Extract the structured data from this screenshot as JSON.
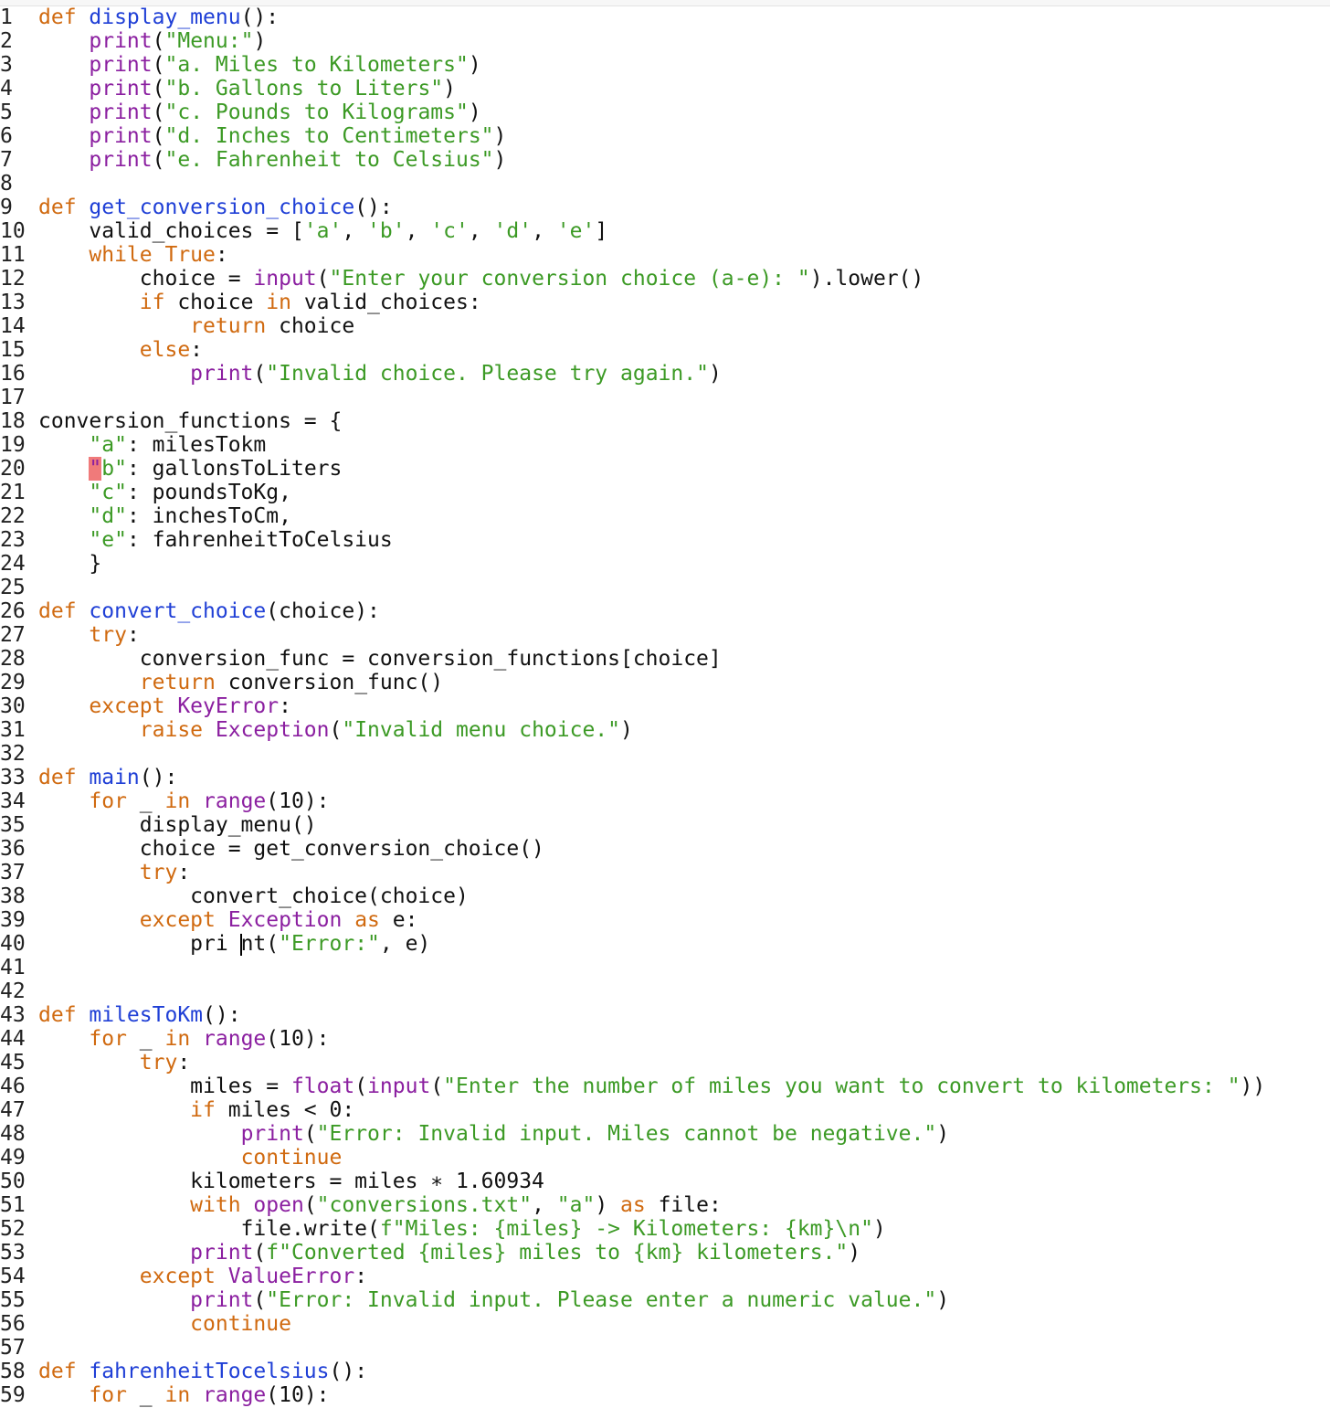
{
  "colors": {
    "keyword": "#d06a10",
    "function_name": "#1f3fd6",
    "builtin": "#8b1fa0",
    "string": "#3c9a25",
    "text": "#111111",
    "highlight": "#f07a7a"
  },
  "editor": {
    "lines": [
      {
        "n": "1",
        "tokens": [
          {
            "t": "kw",
            "v": "def "
          },
          {
            "t": "def",
            "v": "display_menu"
          },
          {
            "t": "text",
            "v": "():"
          }
        ]
      },
      {
        "n": "2",
        "tokens": [
          {
            "t": "text",
            "v": "    "
          },
          {
            "t": "builtin",
            "v": "print"
          },
          {
            "t": "text",
            "v": "("
          },
          {
            "t": "str",
            "v": "\"Menu:\""
          },
          {
            "t": "text",
            "v": ")"
          }
        ]
      },
      {
        "n": "3",
        "tokens": [
          {
            "t": "text",
            "v": "    "
          },
          {
            "t": "builtin",
            "v": "print"
          },
          {
            "t": "text",
            "v": "("
          },
          {
            "t": "str",
            "v": "\"a. Miles to Kilometers\""
          },
          {
            "t": "text",
            "v": ")"
          }
        ]
      },
      {
        "n": "4",
        "tokens": [
          {
            "t": "text",
            "v": "    "
          },
          {
            "t": "builtin",
            "v": "print"
          },
          {
            "t": "text",
            "v": "("
          },
          {
            "t": "str",
            "v": "\"b. Gallons to Liters\""
          },
          {
            "t": "text",
            "v": ")"
          }
        ]
      },
      {
        "n": "5",
        "tokens": [
          {
            "t": "text",
            "v": "    "
          },
          {
            "t": "builtin",
            "v": "print"
          },
          {
            "t": "text",
            "v": "("
          },
          {
            "t": "str",
            "v": "\"c. Pounds to Kilograms\""
          },
          {
            "t": "text",
            "v": ")"
          }
        ]
      },
      {
        "n": "6",
        "tokens": [
          {
            "t": "text",
            "v": "    "
          },
          {
            "t": "builtin",
            "v": "print"
          },
          {
            "t": "text",
            "v": "("
          },
          {
            "t": "str",
            "v": "\"d. Inches to Centimeters\""
          },
          {
            "t": "text",
            "v": ")"
          }
        ]
      },
      {
        "n": "7",
        "tokens": [
          {
            "t": "text",
            "v": "    "
          },
          {
            "t": "builtin",
            "v": "print"
          },
          {
            "t": "text",
            "v": "("
          },
          {
            "t": "str",
            "v": "\"e. Fahrenheit to Celsius\""
          },
          {
            "t": "text",
            "v": ")"
          }
        ]
      },
      {
        "n": "8",
        "tokens": []
      },
      {
        "n": "9",
        "tokens": [
          {
            "t": "kw",
            "v": "def "
          },
          {
            "t": "def",
            "v": "get_conversion_choice"
          },
          {
            "t": "text",
            "v": "():"
          }
        ]
      },
      {
        "n": "10",
        "tokens": [
          {
            "t": "text",
            "v": "    valid_choices = ["
          },
          {
            "t": "str",
            "v": "'a'"
          },
          {
            "t": "text",
            "v": ", "
          },
          {
            "t": "str",
            "v": "'b'"
          },
          {
            "t": "text",
            "v": ", "
          },
          {
            "t": "str",
            "v": "'c'"
          },
          {
            "t": "text",
            "v": ", "
          },
          {
            "t": "str",
            "v": "'d'"
          },
          {
            "t": "text",
            "v": ", "
          },
          {
            "t": "str",
            "v": "'e'"
          },
          {
            "t": "text",
            "v": "]"
          }
        ]
      },
      {
        "n": "11",
        "tokens": [
          {
            "t": "text",
            "v": "    "
          },
          {
            "t": "kw",
            "v": "while True"
          },
          {
            "t": "text",
            "v": ":"
          }
        ]
      },
      {
        "n": "12",
        "tokens": [
          {
            "t": "text",
            "v": "        choice = "
          },
          {
            "t": "builtin",
            "v": "input"
          },
          {
            "t": "text",
            "v": "("
          },
          {
            "t": "str",
            "v": "\"Enter your conversion choice (a-e): \""
          },
          {
            "t": "text",
            "v": ").lower()"
          }
        ]
      },
      {
        "n": "13",
        "tokens": [
          {
            "t": "text",
            "v": "        "
          },
          {
            "t": "kw",
            "v": "if"
          },
          {
            "t": "text",
            "v": " choice "
          },
          {
            "t": "kw",
            "v": "in"
          },
          {
            "t": "text",
            "v": " valid_choices:"
          }
        ]
      },
      {
        "n": "14",
        "tokens": [
          {
            "t": "text",
            "v": "            "
          },
          {
            "t": "kw",
            "v": "return"
          },
          {
            "t": "text",
            "v": " choice"
          }
        ]
      },
      {
        "n": "15",
        "tokens": [
          {
            "t": "text",
            "v": "        "
          },
          {
            "t": "kw",
            "v": "else"
          },
          {
            "t": "text",
            "v": ":"
          }
        ]
      },
      {
        "n": "16",
        "tokens": [
          {
            "t": "text",
            "v": "            "
          },
          {
            "t": "builtin",
            "v": "print"
          },
          {
            "t": "text",
            "v": "("
          },
          {
            "t": "str",
            "v": "\"Invalid choice. Please try again.\""
          },
          {
            "t": "text",
            "v": ")"
          }
        ]
      },
      {
        "n": "17",
        "tokens": []
      },
      {
        "n": "18",
        "tokens": [
          {
            "t": "text",
            "v": "conversion_functions = {"
          }
        ]
      },
      {
        "n": "19",
        "tokens": [
          {
            "t": "text",
            "v": "    "
          },
          {
            "t": "str",
            "v": "\"a\""
          },
          {
            "t": "text",
            "v": ": milesTokm"
          }
        ]
      },
      {
        "n": "20",
        "tokens": [
          {
            "t": "text",
            "v": "    "
          },
          {
            "t": "hl",
            "v": "\""
          },
          {
            "t": "str",
            "v": "b\""
          },
          {
            "t": "text",
            "v": ": gallonsToLiters"
          }
        ]
      },
      {
        "n": "21",
        "tokens": [
          {
            "t": "text",
            "v": "    "
          },
          {
            "t": "str",
            "v": "\"c\""
          },
          {
            "t": "text",
            "v": ": poundsToKg,"
          }
        ]
      },
      {
        "n": "22",
        "tokens": [
          {
            "t": "text",
            "v": "    "
          },
          {
            "t": "str",
            "v": "\"d\""
          },
          {
            "t": "text",
            "v": ": inchesToCm,"
          }
        ]
      },
      {
        "n": "23",
        "tokens": [
          {
            "t": "text",
            "v": "    "
          },
          {
            "t": "str",
            "v": "\"e\""
          },
          {
            "t": "text",
            "v": ": fahrenheitToCelsius"
          }
        ]
      },
      {
        "n": "24",
        "tokens": [
          {
            "t": "text",
            "v": "    }"
          }
        ]
      },
      {
        "n": "25",
        "tokens": []
      },
      {
        "n": "26",
        "tokens": [
          {
            "t": "kw",
            "v": "def "
          },
          {
            "t": "def",
            "v": "convert_choice"
          },
          {
            "t": "text",
            "v": "(choice):"
          }
        ]
      },
      {
        "n": "27",
        "tokens": [
          {
            "t": "text",
            "v": "    "
          },
          {
            "t": "kw",
            "v": "try"
          },
          {
            "t": "text",
            "v": ":"
          }
        ]
      },
      {
        "n": "28",
        "tokens": [
          {
            "t": "text",
            "v": "        conversion_func = conversion_functions[choice]"
          }
        ]
      },
      {
        "n": "29",
        "tokens": [
          {
            "t": "text",
            "v": "        "
          },
          {
            "t": "kw",
            "v": "return"
          },
          {
            "t": "text",
            "v": " conversion_func()"
          }
        ]
      },
      {
        "n": "30",
        "tokens": [
          {
            "t": "text",
            "v": "    "
          },
          {
            "t": "kw",
            "v": "except "
          },
          {
            "t": "builtin",
            "v": "KeyError"
          },
          {
            "t": "text",
            "v": ":"
          }
        ]
      },
      {
        "n": "31",
        "tokens": [
          {
            "t": "text",
            "v": "        "
          },
          {
            "t": "kw",
            "v": "raise "
          },
          {
            "t": "builtin",
            "v": "Exception"
          },
          {
            "t": "text",
            "v": "("
          },
          {
            "t": "str",
            "v": "\"Invalid menu choice.\""
          },
          {
            "t": "text",
            "v": ")"
          }
        ]
      },
      {
        "n": "32",
        "tokens": []
      },
      {
        "n": "33",
        "tokens": [
          {
            "t": "kw",
            "v": "def "
          },
          {
            "t": "def",
            "v": "main"
          },
          {
            "t": "text",
            "v": "():"
          }
        ]
      },
      {
        "n": "34",
        "tokens": [
          {
            "t": "text",
            "v": "    "
          },
          {
            "t": "kw",
            "v": "for"
          },
          {
            "t": "text",
            "v": " _ "
          },
          {
            "t": "kw",
            "v": "in "
          },
          {
            "t": "builtin",
            "v": "range"
          },
          {
            "t": "text",
            "v": "(10):"
          }
        ]
      },
      {
        "n": "35",
        "tokens": [
          {
            "t": "text",
            "v": "        display_menu()"
          }
        ]
      },
      {
        "n": "36",
        "tokens": [
          {
            "t": "text",
            "v": "        choice = get_conversion_choice()"
          }
        ]
      },
      {
        "n": "37",
        "tokens": [
          {
            "t": "text",
            "v": "        "
          },
          {
            "t": "kw",
            "v": "try"
          },
          {
            "t": "text",
            "v": ":"
          }
        ]
      },
      {
        "n": "38",
        "tokens": [
          {
            "t": "text",
            "v": "            convert_choice(choice)"
          }
        ]
      },
      {
        "n": "39",
        "tokens": [
          {
            "t": "text",
            "v": "        "
          },
          {
            "t": "kw",
            "v": "except "
          },
          {
            "t": "builtin",
            "v": "Exception"
          },
          {
            "t": "kw",
            "v": " as"
          },
          {
            "t": "text",
            "v": " e:"
          }
        ]
      },
      {
        "n": "40",
        "tokens": [
          {
            "t": "text",
            "v": "            pri "
          },
          {
            "t": "caret",
            "v": ""
          },
          {
            "t": "text",
            "v": "nt("
          },
          {
            "t": "str",
            "v": "\"Error:\""
          },
          {
            "t": "text",
            "v": ", e)"
          }
        ]
      },
      {
        "n": "41",
        "tokens": []
      },
      {
        "n": "42",
        "tokens": []
      },
      {
        "n": "43",
        "tokens": [
          {
            "t": "kw",
            "v": "def "
          },
          {
            "t": "def",
            "v": "milesToKm"
          },
          {
            "t": "text",
            "v": "():"
          }
        ]
      },
      {
        "n": "44",
        "tokens": [
          {
            "t": "text",
            "v": "    "
          },
          {
            "t": "kw",
            "v": "for"
          },
          {
            "t": "text",
            "v": " _ "
          },
          {
            "t": "kw",
            "v": "in "
          },
          {
            "t": "builtin",
            "v": "range"
          },
          {
            "t": "text",
            "v": "(10):"
          }
        ]
      },
      {
        "n": "45",
        "tokens": [
          {
            "t": "text",
            "v": "        "
          },
          {
            "t": "kw",
            "v": "try"
          },
          {
            "t": "text",
            "v": ":"
          }
        ]
      },
      {
        "n": "46",
        "tokens": [
          {
            "t": "text",
            "v": "            miles = "
          },
          {
            "t": "builtin",
            "v": "float"
          },
          {
            "t": "text",
            "v": "("
          },
          {
            "t": "builtin",
            "v": "input"
          },
          {
            "t": "text",
            "v": "("
          },
          {
            "t": "str",
            "v": "\"Enter the number of miles you want to convert to kilometers: \""
          },
          {
            "t": "text",
            "v": "))"
          }
        ]
      },
      {
        "n": "47",
        "tokens": [
          {
            "t": "text",
            "v": "            "
          },
          {
            "t": "kw",
            "v": "if"
          },
          {
            "t": "text",
            "v": " miles < 0:"
          }
        ]
      },
      {
        "n": "48",
        "tokens": [
          {
            "t": "text",
            "v": "                "
          },
          {
            "t": "builtin",
            "v": "print"
          },
          {
            "t": "text",
            "v": "("
          },
          {
            "t": "str",
            "v": "\"Error: Invalid input. Miles cannot be negative.\""
          },
          {
            "t": "text",
            "v": ")"
          }
        ]
      },
      {
        "n": "49",
        "tokens": [
          {
            "t": "text",
            "v": "                "
          },
          {
            "t": "kw",
            "v": "continue"
          }
        ]
      },
      {
        "n": "50",
        "tokens": [
          {
            "t": "text",
            "v": "            kilometers = miles ∗ 1.60934"
          }
        ]
      },
      {
        "n": "51",
        "tokens": [
          {
            "t": "text",
            "v": "            "
          },
          {
            "t": "kw",
            "v": "with "
          },
          {
            "t": "builtin",
            "v": "open"
          },
          {
            "t": "text",
            "v": "("
          },
          {
            "t": "str",
            "v": "\"conversions.txt\""
          },
          {
            "t": "text",
            "v": ", "
          },
          {
            "t": "str",
            "v": "\"a\""
          },
          {
            "t": "text",
            "v": ") "
          },
          {
            "t": "kw",
            "v": "as"
          },
          {
            "t": "text",
            "v": " file:"
          }
        ]
      },
      {
        "n": "52",
        "tokens": [
          {
            "t": "text",
            "v": "                file.write("
          },
          {
            "t": "str",
            "v": "f\"Miles: {miles} -> Kilometers: {km}\\n\""
          },
          {
            "t": "text",
            "v": ")"
          }
        ]
      },
      {
        "n": "53",
        "tokens": [
          {
            "t": "text",
            "v": "            "
          },
          {
            "t": "builtin",
            "v": "print"
          },
          {
            "t": "text",
            "v": "("
          },
          {
            "t": "str",
            "v": "f\"Converted {miles} miles to {km} kilometers.\""
          },
          {
            "t": "text",
            "v": ")"
          }
        ]
      },
      {
        "n": "54",
        "tokens": [
          {
            "t": "text",
            "v": "        "
          },
          {
            "t": "kw",
            "v": "except "
          },
          {
            "t": "builtin",
            "v": "ValueError"
          },
          {
            "t": "text",
            "v": ":"
          }
        ]
      },
      {
        "n": "55",
        "tokens": [
          {
            "t": "text",
            "v": "            "
          },
          {
            "t": "builtin",
            "v": "print"
          },
          {
            "t": "text",
            "v": "("
          },
          {
            "t": "str",
            "v": "\"Error: Invalid input. Please enter a numeric value.\""
          },
          {
            "t": "text",
            "v": ")"
          }
        ]
      },
      {
        "n": "56",
        "tokens": [
          {
            "t": "text",
            "v": "            "
          },
          {
            "t": "kw",
            "v": "continue"
          }
        ]
      },
      {
        "n": "57",
        "tokens": []
      },
      {
        "n": "58",
        "tokens": [
          {
            "t": "kw",
            "v": "def "
          },
          {
            "t": "def",
            "v": "fahrenheitTocelsius"
          },
          {
            "t": "text",
            "v": "():"
          }
        ]
      },
      {
        "n": "59",
        "tokens": [
          {
            "t": "text",
            "v": "    "
          },
          {
            "t": "kw",
            "v": "for"
          },
          {
            "t": "text",
            "v": " _ "
          },
          {
            "t": "kw",
            "v": "in "
          },
          {
            "t": "builtin",
            "v": "range"
          },
          {
            "t": "text",
            "v": "(10):"
          }
        ]
      }
    ]
  }
}
